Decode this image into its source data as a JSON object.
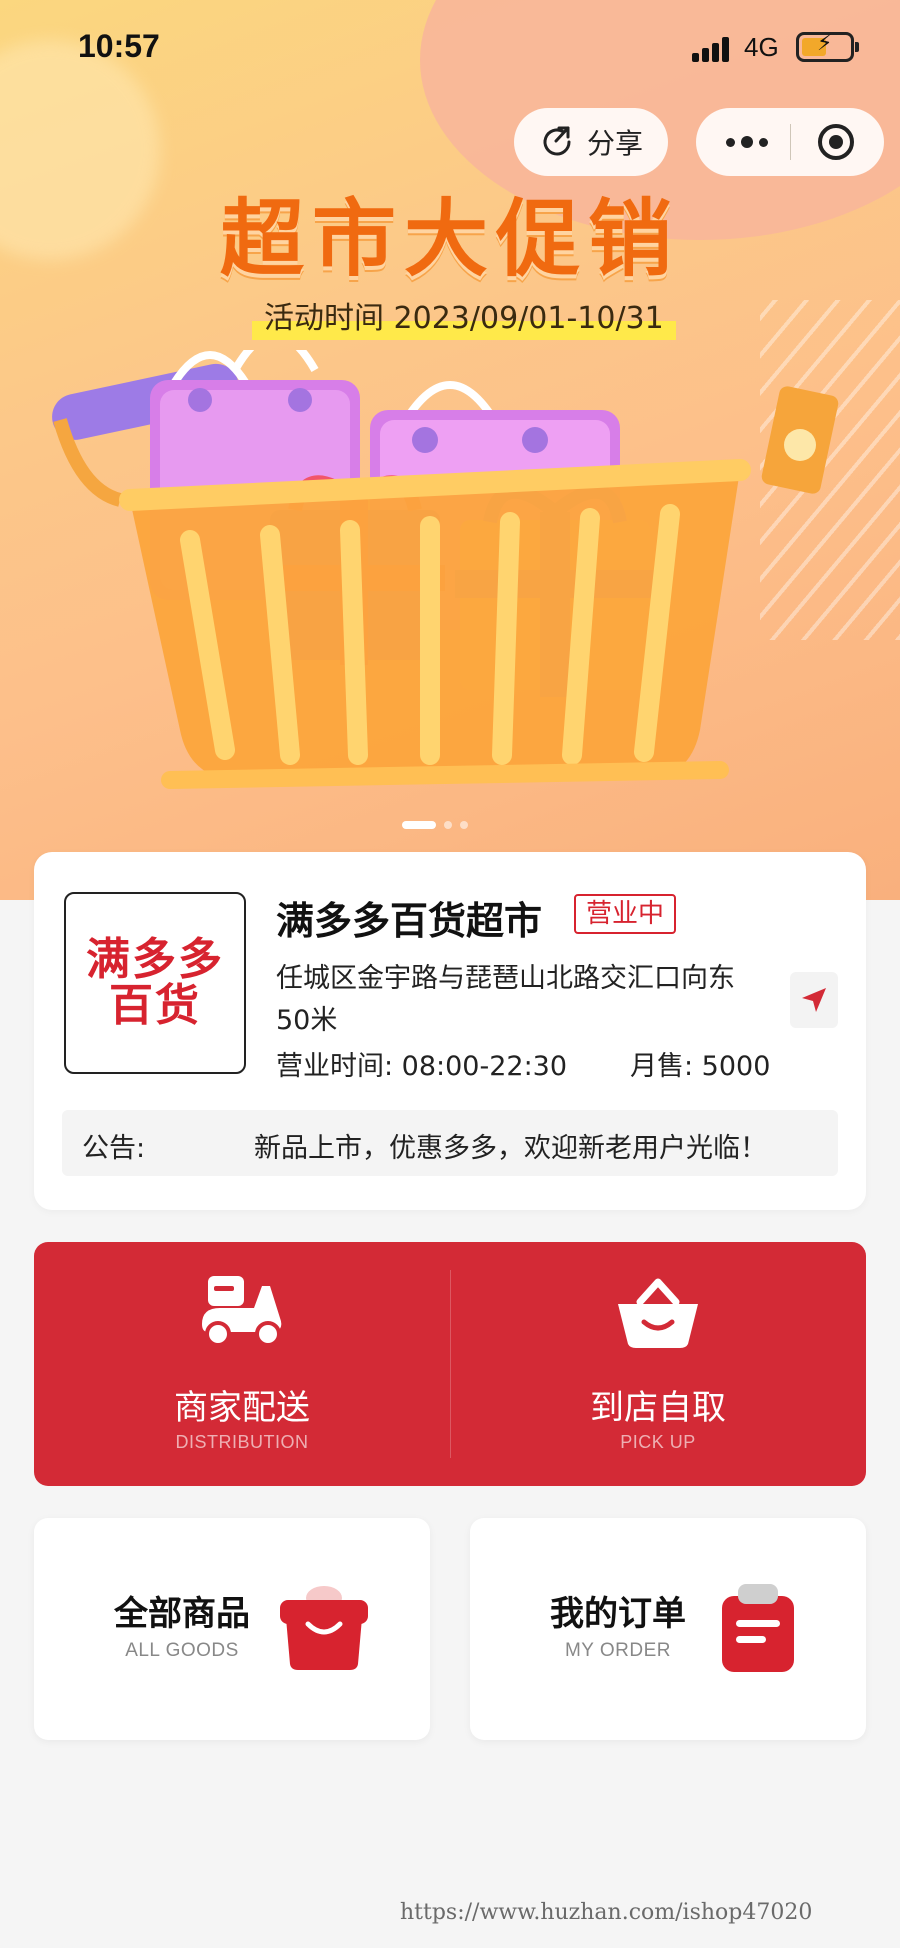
{
  "status_bar": {
    "time": "10:57",
    "network": "4G"
  },
  "banner": {
    "share_label": "分享",
    "title": "超市大促销",
    "date": "活动时间 2023/09/01-10/31",
    "pager_total": 3,
    "pager_active": 1
  },
  "store": {
    "logo_line1": "满多多",
    "logo_line2": "百货",
    "name": "满多多百货超市",
    "status_badge": "营业中",
    "address": "任城区金宇路与琵琶山北路交汇口向东50米",
    "hours": "营业时间: 08:00-22:30",
    "sales": "月售: 5000",
    "notice_label": "公告:",
    "notice_text": "新品上市，优惠多多，欢迎新老用户光临！"
  },
  "options": [
    {
      "title": "商家配送",
      "subtitle": "DISTRIBUTION",
      "icon": "scooter-icon"
    },
    {
      "title": "到店自取",
      "subtitle": "PICK UP",
      "icon": "basket-icon"
    }
  ],
  "tiles": [
    {
      "title": "全部商品",
      "subtitle": "ALL GOODS",
      "icon": "shopping-bag-icon"
    },
    {
      "title": "我的订单",
      "subtitle": "MY ORDER",
      "icon": "clipboard-icon"
    }
  ],
  "watermark": "https://www.huzhan.com/ishop47020",
  "colors": {
    "brand_red": "#d32a36",
    "promo_orange": "#f06a10",
    "page_bg": "#f5f5f5"
  }
}
